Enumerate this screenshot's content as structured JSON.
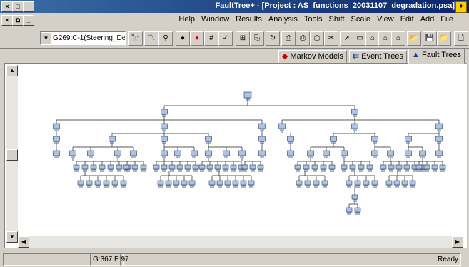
{
  "window": {
    "title": "FaultTree+ - [Project : AS_functions_20031107_degradation.psa]",
    "app_icon": "faulttree-app-icon"
  },
  "menubar": {
    "items": [
      "File",
      "Add",
      "Edit",
      "View",
      "Scale",
      "Shift",
      "Tools",
      "Analysis",
      "Results",
      "Window",
      "Help"
    ]
  },
  "toolbar": {
    "combo1_value": "G269:C-1(Steering_De",
    "combo2_value": ""
  },
  "tabs": [
    {
      "label": "Fault Trees"
    },
    {
      "label": "Event Trees"
    },
    {
      "label": "Markov Models"
    }
  ],
  "statusbar": {
    "ready": "Ready",
    "coords": "G:367 E:97"
  },
  "colors": {
    "titlebar": "#0a246a",
    "gate_fill": "#a9c4e8",
    "gate_stroke": "#2a3a5a"
  }
}
